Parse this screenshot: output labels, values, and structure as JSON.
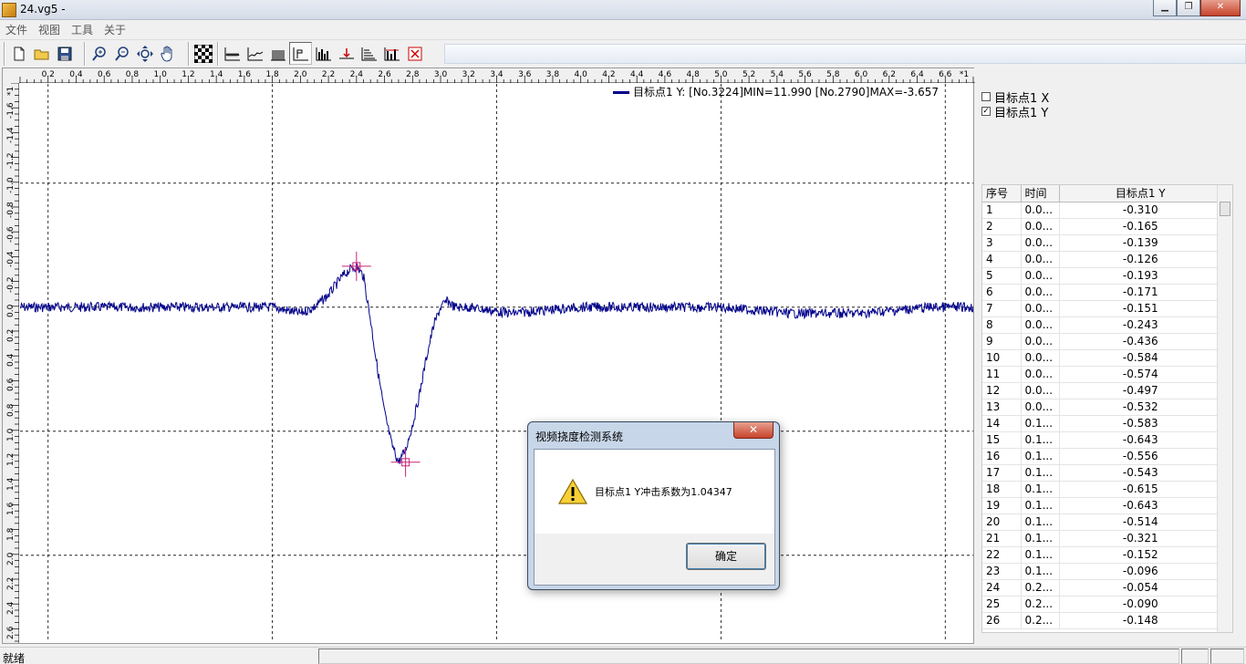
{
  "window": {
    "title": "24.vg5 -",
    "minimize": "▁",
    "restore": "❐",
    "close": "✕"
  },
  "menu": [
    "文件",
    "视图",
    "工具",
    "关于"
  ],
  "toolbar": {
    "groups": [
      [
        "new-file",
        "open-folder",
        "save"
      ],
      [
        "zoom-in",
        "zoom-out",
        "fit",
        "hand"
      ],
      [
        "checker"
      ],
      [
        "chart-a",
        "chart-b",
        "chart-c",
        "chart-d",
        "chart-e",
        "chart-f",
        "chart-g",
        "chart-h",
        "delete"
      ]
    ]
  },
  "chart": {
    "x_ticks": [
      "0.2",
      "0.4",
      "0.6",
      "0.8",
      "1.0",
      "1.2",
      "1.4",
      "1.6",
      "1.8",
      "2.0",
      "2.2",
      "2.4",
      "2.6",
      "2.8",
      "3.0",
      "3.2",
      "3.4",
      "3.6",
      "3.8",
      "4.0",
      "4.2",
      "4.4",
      "4.6",
      "4.8",
      "5.0",
      "5.2",
      "5.4",
      "5.6",
      "5.8",
      "6.0",
      "6.2",
      "6.4",
      "6.6"
    ],
    "x_unit": "*1",
    "y_ticks": [
      "-1.6",
      "-1.4",
      "-1.2",
      "-1.0",
      "-0.8",
      "-0.6",
      "-0.4",
      "-0.2",
      "0.0",
      "0.2",
      "0.4",
      "0.6",
      "0.8",
      "1.0",
      "1.2",
      "1.4",
      "1.6",
      "1.8",
      "2.0",
      "2.2",
      "2.4",
      "2.6"
    ],
    "y_unit": "*1",
    "legend": "目标点1 Y: [No.3224]MIN=11.990  [No.2790]MAX=-3.657",
    "line_color": "#00008b",
    "marker_color": "#cc2277"
  },
  "chart_data": {
    "type": "line",
    "x_range": [
      0.0,
      6.8
    ],
    "y_range": [
      -1.8,
      2.7
    ],
    "y_inverted": true,
    "grid": true,
    "series": [
      {
        "name": "目标点1 Y",
        "x": [
          0.0,
          0.5,
          1.0,
          1.5,
          1.8,
          2.0,
          2.1,
          2.2,
          2.3,
          2.35,
          2.4,
          2.45,
          2.5,
          2.55,
          2.6,
          2.65,
          2.7,
          2.75,
          2.8,
          2.85,
          2.9,
          2.95,
          3.0,
          3.05,
          3.1,
          3.2,
          3.5,
          4.0,
          4.5,
          5.0,
          5.5,
          6.0,
          6.5,
          6.8
        ],
        "y": [
          0.0,
          0.0,
          0.0,
          0.0,
          0.0,
          0.05,
          0.0,
          -0.1,
          -0.25,
          -0.3,
          -0.33,
          -0.25,
          0.1,
          0.5,
          0.85,
          1.1,
          1.25,
          1.15,
          0.95,
          0.7,
          0.4,
          0.15,
          0.0,
          -0.05,
          0.0,
          0.0,
          0.05,
          0.0,
          0.0,
          0.0,
          0.05,
          0.05,
          0.0,
          0.0
        ]
      }
    ],
    "markers": [
      {
        "x": 2.4,
        "y": -0.33
      },
      {
        "x": 2.75,
        "y": 1.25
      }
    ]
  },
  "checks": [
    {
      "label": "目标点1 X",
      "checked": false,
      "mark": ""
    },
    {
      "label": "目标点1 Y",
      "checked": true,
      "mark": "✓"
    }
  ],
  "table": {
    "headers": [
      "序号",
      "时间",
      "目标点1 Y"
    ],
    "rows": [
      [
        "1",
        "0.0...",
        "-0.310"
      ],
      [
        "2",
        "0.0...",
        "-0.165"
      ],
      [
        "3",
        "0.0...",
        "-0.139"
      ],
      [
        "4",
        "0.0...",
        "-0.126"
      ],
      [
        "5",
        "0.0...",
        "-0.193"
      ],
      [
        "6",
        "0.0...",
        "-0.171"
      ],
      [
        "7",
        "0.0...",
        "-0.151"
      ],
      [
        "8",
        "0.0...",
        "-0.243"
      ],
      [
        "9",
        "0.0...",
        "-0.436"
      ],
      [
        "10",
        "0.0...",
        "-0.584"
      ],
      [
        "11",
        "0.0...",
        "-0.574"
      ],
      [
        "12",
        "0.0...",
        "-0.497"
      ],
      [
        "13",
        "0.0...",
        "-0.532"
      ],
      [
        "14",
        "0.1...",
        "-0.583"
      ],
      [
        "15",
        "0.1...",
        "-0.643"
      ],
      [
        "16",
        "0.1...",
        "-0.556"
      ],
      [
        "17",
        "0.1...",
        "-0.543"
      ],
      [
        "18",
        "0.1...",
        "-0.615"
      ],
      [
        "19",
        "0.1...",
        "-0.643"
      ],
      [
        "20",
        "0.1...",
        "-0.514"
      ],
      [
        "21",
        "0.1...",
        "-0.321"
      ],
      [
        "22",
        "0.1...",
        "-0.152"
      ],
      [
        "23",
        "0.1...",
        "-0.096"
      ],
      [
        "24",
        "0.2...",
        "-0.054"
      ],
      [
        "25",
        "0.2...",
        "-0.090"
      ],
      [
        "26",
        "0.2...",
        "-0.148"
      ]
    ]
  },
  "status": {
    "text": "就绪"
  },
  "dialog": {
    "title": "视频挠度检测系统",
    "message": "目标点1 Y冲击系数为1.04347",
    "ok_label": "确定",
    "close": "✕"
  }
}
